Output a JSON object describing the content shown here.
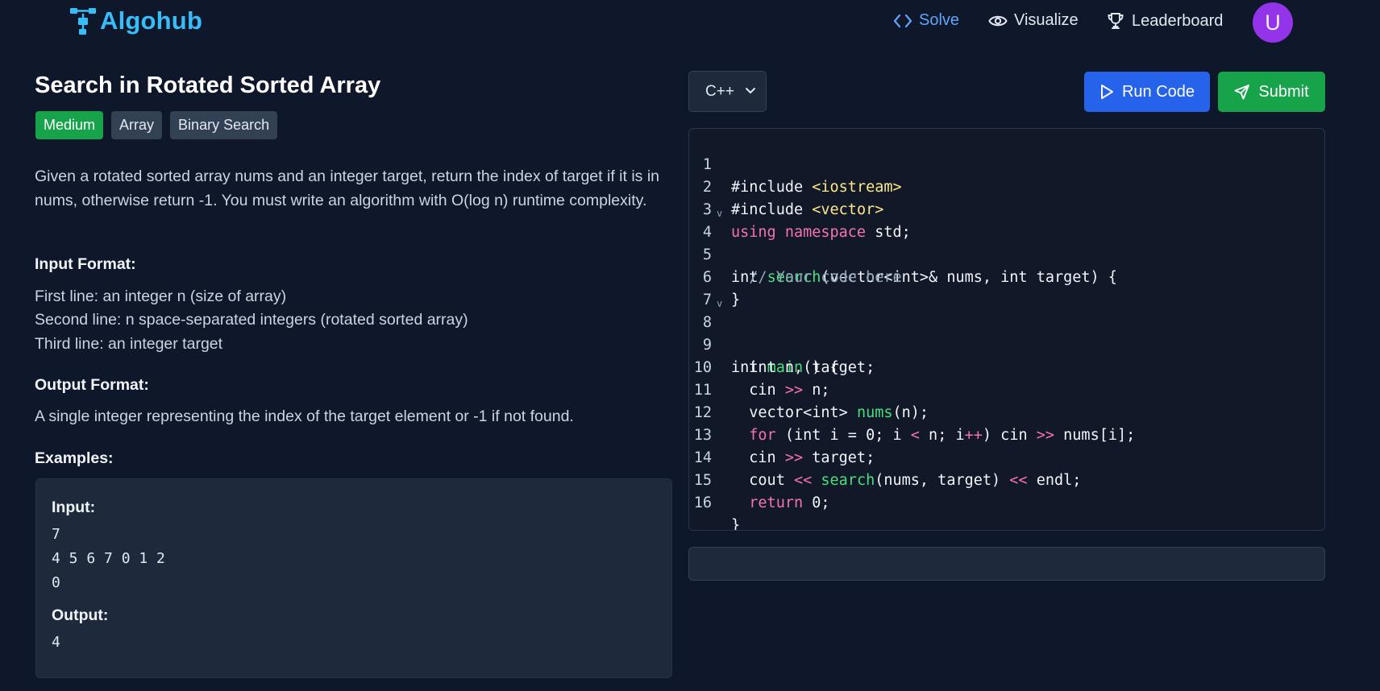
{
  "app": {
    "logo_text": "Algohub"
  },
  "nav": {
    "solve": "Solve",
    "visualize": "Visualize",
    "leaderboard": "Leaderboard",
    "avatar_initial": "U"
  },
  "problem": {
    "title": "Search in Rotated Sorted Array",
    "tags": [
      "Medium",
      "Array",
      "Binary Search"
    ],
    "description": "Given a rotated sorted array nums and an integer target, return the index of target if it is in nums, otherwise return -1. You must write an algorithm with O(log n) runtime complexity.",
    "input_format_heading": "Input Format:",
    "input_format_lines": [
      "First line: an integer n (size of array)",
      "Second line: n space-separated integers (rotated sorted array)",
      "Third line: an integer target"
    ],
    "output_format_heading": "Output Format:",
    "output_format_text": "A single integer representing the index of the target element or -1 if not found.",
    "examples_heading": "Examples:",
    "example": {
      "input_label": "Input:",
      "input_lines": [
        "7",
        "4 5 6 7 0 1 2",
        "0"
      ],
      "output_label": "Output:",
      "output_value": "4"
    }
  },
  "editor": {
    "language": "C++",
    "run_label": "Run Code",
    "submit_label": "Submit",
    "line_numbers": [
      "1",
      "2",
      "3",
      "4",
      "5",
      "6",
      "7",
      "8",
      "9",
      "10",
      "11",
      "12",
      "13",
      "14",
      "15",
      "16"
    ],
    "fold_markers": [
      "4",
      "8"
    ]
  },
  "colors": {
    "background": "#0f172a",
    "accent_blue": "#2563eb",
    "accent_green": "#16a34a",
    "logo": "#38bdf8",
    "avatar": "#9333ea"
  },
  "icons": {
    "logo": "flowchart-icon",
    "solve": "code-brackets-icon",
    "visualize": "eye-icon",
    "leaderboard": "trophy-icon",
    "run": "play-icon",
    "submit": "send-icon",
    "select": "chevron-down-icon"
  }
}
